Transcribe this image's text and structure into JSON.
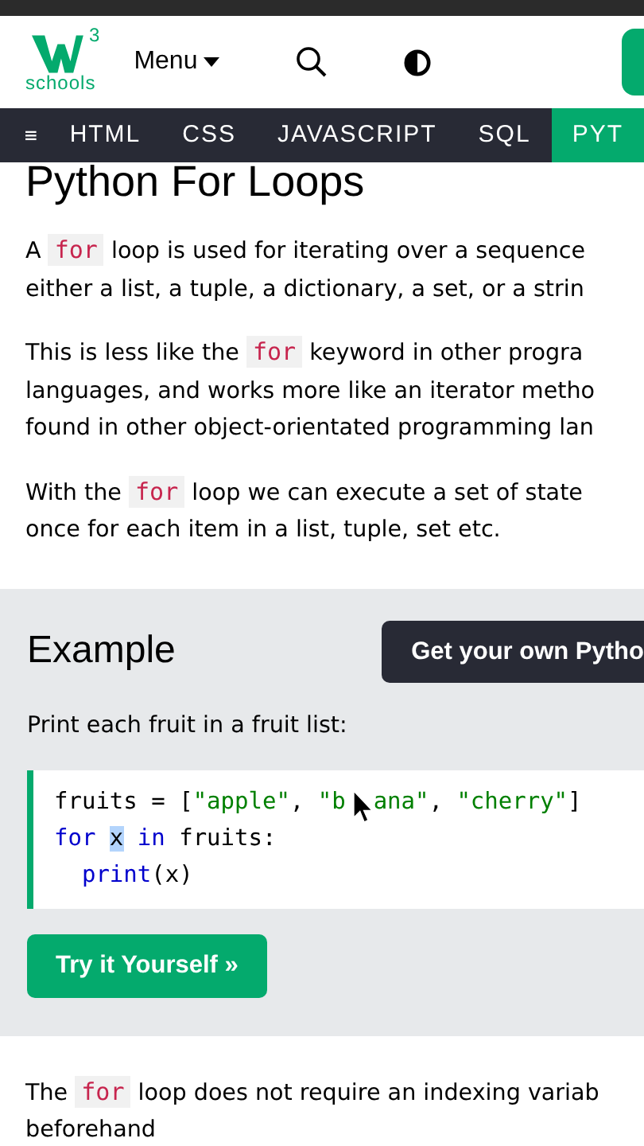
{
  "header": {
    "logo": {
      "superscript": "3",
      "wordmark": "schools"
    },
    "menu": "Menu"
  },
  "nav": [
    {
      "label": "HTML",
      "selected": false
    },
    {
      "label": "CSS",
      "selected": false
    },
    {
      "label": "JAVASCRIPT",
      "selected": false
    },
    {
      "label": "SQL",
      "selected": false
    },
    {
      "label": "PYT",
      "selected": true
    }
  ],
  "title": "Python For Loops",
  "intro": [
    {
      "parts": [
        {
          "kind": "text",
          "text": "A "
        },
        {
          "kind": "code",
          "text": "for"
        },
        {
          "kind": "text",
          "text": " loop is used for iterating over a sequence"
        },
        {
          "kind": "break"
        },
        {
          "kind": "text",
          "text": "either a list, a tuple, a dictionary, a set, or a strin"
        }
      ]
    },
    {
      "parts": [
        {
          "kind": "text",
          "text": "This is less like the "
        },
        {
          "kind": "code",
          "text": "for"
        },
        {
          "kind": "text",
          "text": " keyword in other progra"
        },
        {
          "kind": "break"
        },
        {
          "kind": "text",
          "text": "languages, and works more like an iterator metho"
        },
        {
          "kind": "break"
        },
        {
          "kind": "text",
          "text": "found in other object-orientated programming lan"
        }
      ]
    },
    {
      "parts": [
        {
          "kind": "text",
          "text": "With the "
        },
        {
          "kind": "code",
          "text": "for"
        },
        {
          "kind": "text",
          "text": " loop we can execute a set of state"
        },
        {
          "kind": "break"
        },
        {
          "kind": "text",
          "text": "once for each item in a list, tuple, set etc."
        }
      ]
    }
  ],
  "example": {
    "heading": "Example",
    "own_button": "Get your own Pytho",
    "caption": "Print each fruit in a fruit list:",
    "code": [
      [
        {
          "kind": "plain",
          "text": "fruits = ["
        },
        {
          "kind": "string",
          "text": "\"apple\""
        },
        {
          "kind": "plain",
          "text": ", "
        },
        {
          "kind": "string",
          "text": "\"b"
        },
        {
          "kind": "string",
          "text": "ana\"",
          "gap_before": true
        },
        {
          "kind": "plain",
          "text": ", "
        },
        {
          "kind": "string",
          "text": "\"cherry\""
        },
        {
          "kind": "plain",
          "text": "]"
        }
      ],
      [
        {
          "kind": "keyword",
          "text": "for "
        },
        {
          "kind": "selected",
          "text": "x"
        },
        {
          "kind": "keyword",
          "text": " in"
        },
        {
          "kind": "plain",
          "text": " fruits:"
        }
      ],
      [
        {
          "kind": "builtin",
          "text": "  print"
        },
        {
          "kind": "plain",
          "text": "(x)"
        }
      ]
    ],
    "try_button": "Try it Yourself »"
  },
  "outro": {
    "parts": [
      {
        "kind": "text",
        "text": "The "
      },
      {
        "kind": "code",
        "text": "for"
      },
      {
        "kind": "text",
        "text": " loop does not require an indexing variab"
      },
      {
        "kind": "break"
      },
      {
        "kind": "text",
        "text": "beforehand"
      }
    ]
  }
}
